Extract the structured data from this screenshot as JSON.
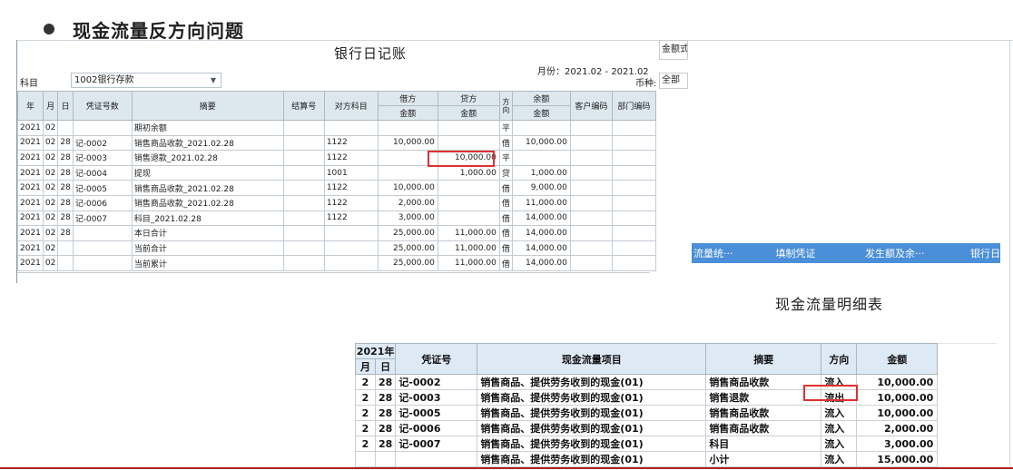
{
  "slide": {
    "title": "现金流量反方向问题"
  },
  "bank_journal": {
    "title": "银行日记账",
    "amount_style": "金额式",
    "period": "月份：2021.02 - 2021.02",
    "subject_label": "科目",
    "subject_value": "1002银行存款",
    "currency_label": "币种:",
    "currency_value": "全部",
    "headers": {
      "year": "年",
      "month": "月",
      "day": "日",
      "voucher": "凭证号数",
      "summary": "摘要",
      "settlement": "结算号",
      "counter": "对方科目",
      "debit": "借方",
      "credit": "贷方",
      "direction": "方向",
      "balance": "余额",
      "customer": "客户编码",
      "dept": "部门编码",
      "amount": "金额"
    },
    "rows": [
      {
        "y": "2021",
        "m": "02",
        "d": "",
        "voucher": "",
        "summary": "期初余额",
        "settle": "",
        "counter": "",
        "debit": "",
        "credit": "",
        "dir": "平",
        "balance": ""
      },
      {
        "y": "2021",
        "m": "02",
        "d": "28",
        "voucher": "记-0002",
        "summary": "销售商品收款_2021.02.28",
        "settle": "",
        "counter": "1122",
        "debit": "10,000.00",
        "credit": "",
        "dir": "借",
        "balance": "10,000.00"
      },
      {
        "y": "2021",
        "m": "02",
        "d": "28",
        "voucher": "记-0003",
        "summary": "销售退款_2021.02.28",
        "settle": "",
        "counter": "1122",
        "debit": "",
        "credit": "10,000.00",
        "dir": "平",
        "balance": ""
      },
      {
        "y": "2021",
        "m": "02",
        "d": "28",
        "voucher": "记-0004",
        "summary": "提现",
        "settle": "",
        "counter": "1001",
        "debit": "",
        "credit": "1,000.00",
        "dir": "贷",
        "balance": "1,000.00"
      },
      {
        "y": "2021",
        "m": "02",
        "d": "28",
        "voucher": "记-0005",
        "summary": "销售商品收款_2021.02.28",
        "settle": "",
        "counter": "1122",
        "debit": "10,000.00",
        "credit": "",
        "dir": "借",
        "balance": "9,000.00"
      },
      {
        "y": "2021",
        "m": "02",
        "d": "28",
        "voucher": "记-0006",
        "summary": "销售商品收款_2021.02.28",
        "settle": "",
        "counter": "1122",
        "debit": "2,000.00",
        "credit": "",
        "dir": "借",
        "balance": "11,000.00"
      },
      {
        "y": "2021",
        "m": "02",
        "d": "28",
        "voucher": "记-0007",
        "summary": "科目_2021.02.28",
        "settle": "",
        "counter": "1122",
        "debit": "3,000.00",
        "credit": "",
        "dir": "借",
        "balance": "14,000.00"
      },
      {
        "y": "2021",
        "m": "02",
        "d": "28",
        "voucher": "",
        "summary": "本日合计",
        "settle": "",
        "counter": "",
        "debit": "25,000.00",
        "credit": "11,000.00",
        "dir": "借",
        "balance": "14,000.00"
      },
      {
        "y": "2021",
        "m": "02",
        "d": "",
        "voucher": "",
        "summary": "当前合计",
        "settle": "",
        "counter": "",
        "debit": "25,000.00",
        "credit": "11,000.00",
        "dir": "借",
        "balance": "14,000.00"
      },
      {
        "y": "2021",
        "m": "02",
        "d": "",
        "voucher": "",
        "summary": "当前累计",
        "settle": "",
        "counter": "",
        "debit": "25,000.00",
        "credit": "11,000.00",
        "dir": "借",
        "balance": "14,000.00"
      }
    ]
  },
  "toolbar": {
    "items": [
      "流量统···",
      "填制凭证",
      "发生额及余···",
      "银行日"
    ]
  },
  "cash_flow": {
    "title": "现金流量明细表",
    "headers": {
      "year": "2021年",
      "month": "月",
      "day": "日",
      "voucher": "凭证号",
      "item": "现金流量项目",
      "summary": "摘要",
      "direction": "方向",
      "amount": "金额"
    },
    "rows": [
      {
        "m": "2",
        "d": "28",
        "voucher": "记-0002",
        "item": "销售商品、提供劳务收到的现金(01)",
        "summary": "销售商品收款",
        "dir": "流入",
        "amount": "10,000.00"
      },
      {
        "m": "2",
        "d": "28",
        "voucher": "记-0003",
        "item": "销售商品、提供劳务收到的现金(01)",
        "summary": "销售退款",
        "dir": "流出",
        "amount": "10,000.00"
      },
      {
        "m": "2",
        "d": "28",
        "voucher": "记-0005",
        "item": "销售商品、提供劳务收到的现金(01)",
        "summary": "销售商品收款",
        "dir": "流入",
        "amount": "10,000.00"
      },
      {
        "m": "2",
        "d": "28",
        "voucher": "记-0006",
        "item": "销售商品、提供劳务收到的现金(01)",
        "summary": "销售商品收款",
        "dir": "流入",
        "amount": "2,000.00"
      },
      {
        "m": "2",
        "d": "28",
        "voucher": "记-0007",
        "item": "销售商品、提供劳务收到的现金(01)",
        "summary": "科目",
        "dir": "流入",
        "amount": "3,000.00"
      },
      {
        "m": "",
        "d": "",
        "voucher": "",
        "item": "销售商品、提供劳务收到的现金(01)",
        "summary": "小计",
        "dir": "流入",
        "amount": "15,000.00"
      }
    ]
  },
  "colors": {
    "highlight": "#e03030",
    "toolbar": "#4a8fd8",
    "header_bg": "#dde7ee"
  }
}
